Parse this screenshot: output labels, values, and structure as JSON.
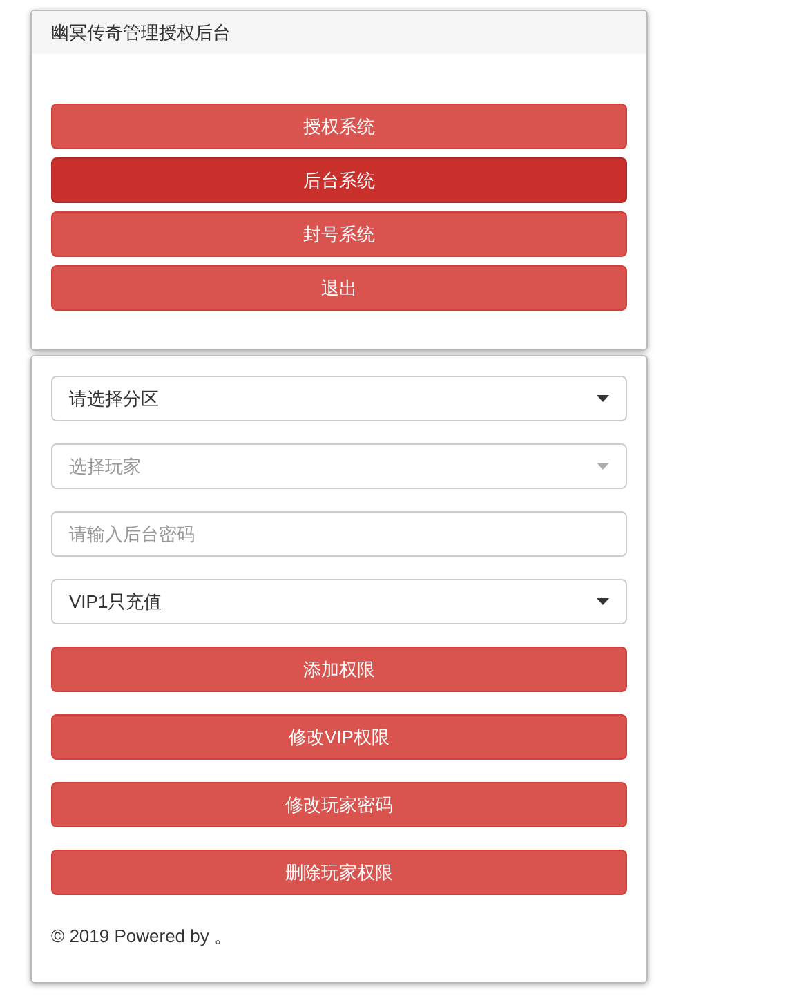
{
  "panel_title": "幽冥传奇管理授权后台",
  "nav_buttons": [
    {
      "label": "授权系统",
      "selected": false
    },
    {
      "label": "后台系统",
      "selected": true
    },
    {
      "label": "封号系统",
      "selected": false
    },
    {
      "label": "退出",
      "selected": false
    }
  ],
  "form_fields": [
    {
      "kind": "select",
      "value": "请选择分区",
      "disabled": false
    },
    {
      "kind": "select",
      "value": "选择玩家",
      "disabled": true
    },
    {
      "kind": "input",
      "placeholder": "请输入后台密码"
    },
    {
      "kind": "select",
      "value": "VIP1只充值",
      "disabled": false
    }
  ],
  "action_buttons": [
    "添加权限",
    "修改VIP权限",
    "修改玩家密码",
    "删除玩家权限"
  ],
  "footer": "© 2019 Powered by 。"
}
